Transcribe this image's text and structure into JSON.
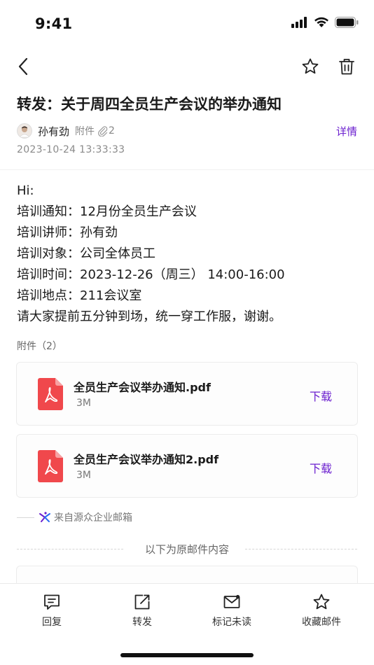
{
  "status_bar": {
    "time": "9:41"
  },
  "nav": {
    "back_icon": "chevron-left-icon",
    "star_icon": "star-icon",
    "trash_icon": "trash-icon"
  },
  "mail": {
    "subject": "转发：关于周四全员生产会议的举办通知",
    "sender": "孙有劲",
    "attachment_label": "附件",
    "attachment_count": "2",
    "detail_link": "详情",
    "date": "2023-10-24  13:33:33",
    "body_lines": [
      "Hi:",
      "培训通知：12月份全员生产会议",
      "培训讲师：孙有劲",
      "培训对象：公司全体员工",
      "培训时间：2023-12-26（周三） 14:00-16:00",
      "培训地点：211会议室",
      "请大家提前五分钟到场，统一穿工作服，谢谢。"
    ]
  },
  "attachments": {
    "heading": "附件（2）",
    "items": [
      {
        "name": "全员生产会议举办通知.pdf",
        "size": "3M",
        "download_label": "下载"
      },
      {
        "name": "全员生产会议举办通知2.pdf",
        "size": "3M",
        "download_label": "下载"
      }
    ]
  },
  "source": {
    "text": "来自源众企业邮箱"
  },
  "original": {
    "divider_text": "以下为原邮件内容"
  },
  "bottom_bar": {
    "reply": "回复",
    "forward": "转发",
    "mark_unread": "标记未读",
    "favorite": "收藏邮件"
  },
  "colors": {
    "accent": "#6b1fcf",
    "pdf_red": "#f0484c"
  }
}
